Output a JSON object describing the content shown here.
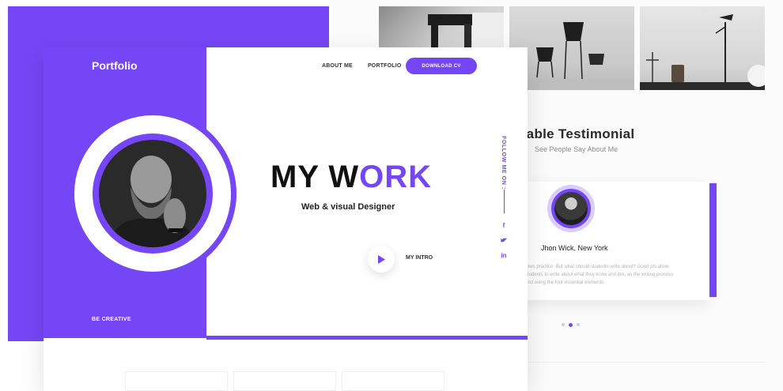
{
  "front": {
    "logo": "Portfolio",
    "nav": {
      "about": "ABOUT ME",
      "portfolio": "PORTFOLIO"
    },
    "download_button": "DOWNLOAD CV",
    "hero": {
      "title_part1": "MY W",
      "title_accent": "O",
      "title_part2": "RK",
      "subtitle": "Web & visual Designer"
    },
    "intro_label": "MY INTRO",
    "follow_label": "FOLLOW ME ON :",
    "social": [
      "f",
      "t",
      "in"
    ],
    "tagline": "BE CREATIVE"
  },
  "testimonial": {
    "title": "uable Testimonial",
    "subtitle": "See People Say About Me",
    "name": "Jhon Wick, New York",
    "quote": "akes practice. But what should students write about? Good pts allow students to write about what they know and like, as the writing process and using the four essential elements."
  },
  "colors": {
    "accent": "#7546f5",
    "text": "#222222"
  },
  "icons": [
    "play-icon",
    "facebook-icon",
    "twitter-icon",
    "linkedin-icon"
  ]
}
